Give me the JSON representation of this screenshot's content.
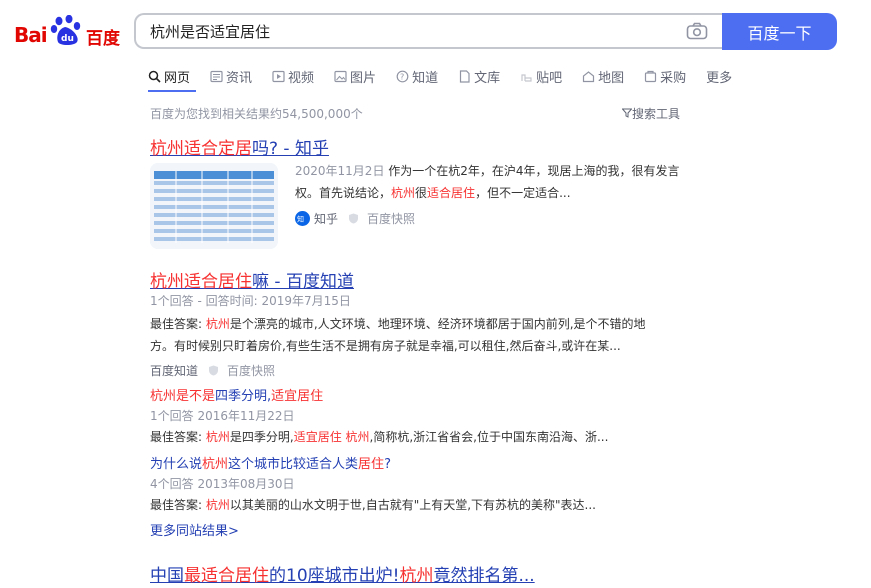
{
  "header": {
    "logo_text_left": "Bai",
    "logo_text_paw": "du",
    "logo_text_right": "百度",
    "search_value": "杭州是否适宜居住",
    "search_button": "百度一下"
  },
  "tabs": [
    {
      "label": "网页",
      "icon": "search-icon"
    },
    {
      "label": "资讯",
      "icon": "news-icon"
    },
    {
      "label": "视频",
      "icon": "video-icon"
    },
    {
      "label": "图片",
      "icon": "image-icon"
    },
    {
      "label": "知道",
      "icon": "question-icon"
    },
    {
      "label": "文库",
      "icon": "doc-icon"
    },
    {
      "label": "贴吧",
      "icon": "tieba-icon"
    },
    {
      "label": "地图",
      "icon": "map-icon"
    },
    {
      "label": "采购",
      "icon": "purchase-icon"
    },
    {
      "label": "更多",
      "icon": ""
    }
  ],
  "result_count": "百度为您找到相关结果约54,500,000个",
  "search_tools": "搜索工具",
  "results": {
    "r1": {
      "title_a": "杭州适合定居",
      "title_b": "吗? - 知乎",
      "date": "2020年11月2日",
      "abs_1": "作为一个在杭2年，在沪4年，现居上海的我，很有发言",
      "abs_2a": "权。首先说结论，",
      "abs_2b": "杭州",
      "abs_2c": "很",
      "abs_2d": "适合居住",
      "abs_2e": "，但不一定适合...",
      "source": "知乎",
      "snapshot": "百度快照"
    },
    "r2": {
      "title_a": "杭州适合居住",
      "title_b": "嘛 - 百度知道",
      "meta": "1个回答 - 回答时间: 2019年7月15日",
      "abs_1a": "最佳答案: ",
      "abs_1b": "杭州",
      "abs_1c": "是个漂亮的城市,人文环境、地理环境、经济环境都居于国内前列,是个不错的地",
      "abs_2": "方。有时候别只盯着房价,有些生活不是拥有房子就是幸福,可以租住,然后奋斗,或许在某...",
      "source": "百度知道",
      "snapshot": "百度快照",
      "sub1_a": "杭州",
      "sub1_b": "是不是",
      "sub1_c": "四季分明,",
      "sub1_d": "适宜居住",
      "sub1_meta": "1个回答   2016年11月22日",
      "sub1_abs_a": "最佳答案: ",
      "sub1_abs_b": "杭州",
      "sub1_abs_c": "是四季分明,",
      "sub1_abs_d": "适宜居住 杭州",
      "sub1_abs_e": ",简称杭,浙江省省会,位于中国东南沿海、浙...",
      "sub2_a": "为什么说",
      "sub2_b": "杭州",
      "sub2_c": "这个城市比较适合人类",
      "sub2_d": "居住",
      "sub2_e": "?",
      "sub2_meta": "4个回答   2013年08月30日",
      "sub2_abs_a": "最佳答案: ",
      "sub2_abs_b": "杭州",
      "sub2_abs_c": "以其美丽的山水文明于世,自古就有\"上有天堂,下有苏杭的美称\"表达...",
      "more": "更多同站结果>"
    },
    "r3": {
      "title_a": "中国",
      "title_b": "最适合居住",
      "title_c": "的10座城市出炉!",
      "title_d": "杭州",
      "title_e": "竟然排名第..."
    }
  },
  "colors": {
    "accent": "#4e6ef2",
    "highlight": "#f73131",
    "link": "#2440b3",
    "logo_red": "#e10602",
    "logo_blue": "#2932e1"
  }
}
